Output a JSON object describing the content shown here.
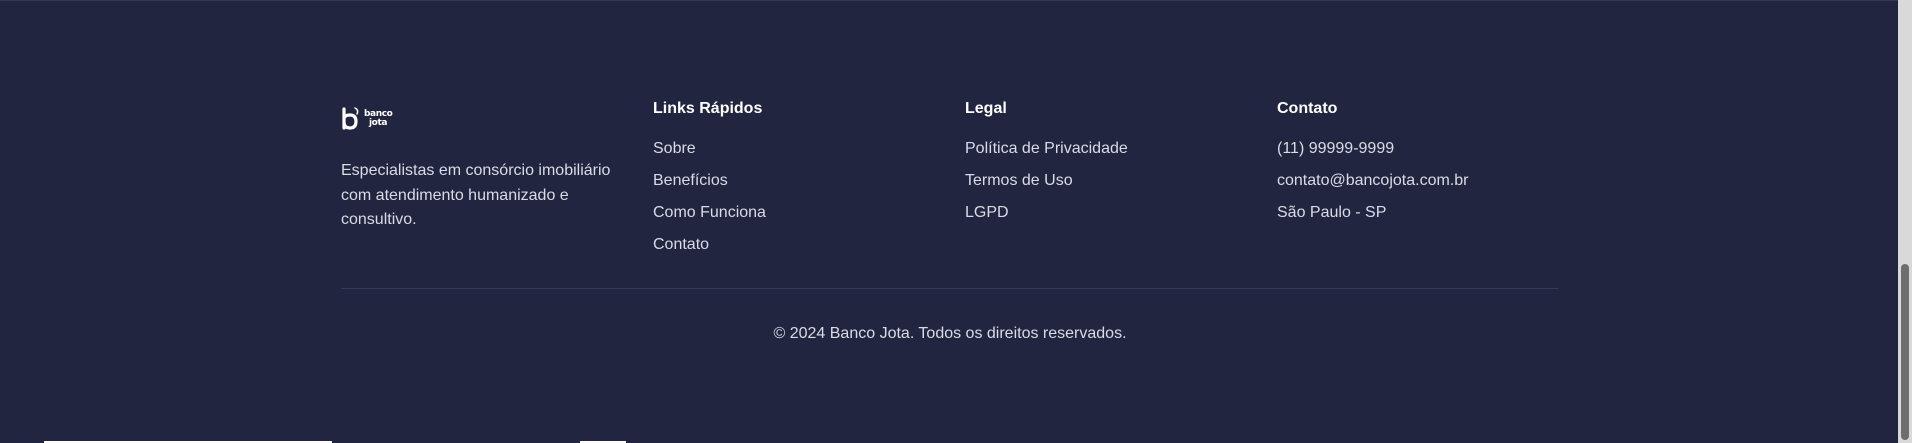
{
  "brand": {
    "logo_line1": "banco",
    "logo_line2": "jota",
    "description": "Especialistas em consórcio imobiliário com atendimento humanizado e consultivo."
  },
  "quick_links": {
    "title": "Links Rápidos",
    "items": [
      "Sobre",
      "Benefícios",
      "Como Funciona",
      "Contato"
    ]
  },
  "legal": {
    "title": "Legal",
    "items": [
      "Política de Privacidade",
      "Termos de Uso",
      "LGPD"
    ]
  },
  "contact": {
    "title": "Contato",
    "items": [
      "(11) 99999-9999",
      "contato@bancojota.com.br",
      "São Paulo - SP"
    ]
  },
  "copyright": "© 2024 Banco Jota. Todos os direitos reservados.",
  "colors": {
    "background": "#22253f",
    "text": "#d9dbe6",
    "heading": "#ffffff",
    "divider": "#34385a"
  }
}
